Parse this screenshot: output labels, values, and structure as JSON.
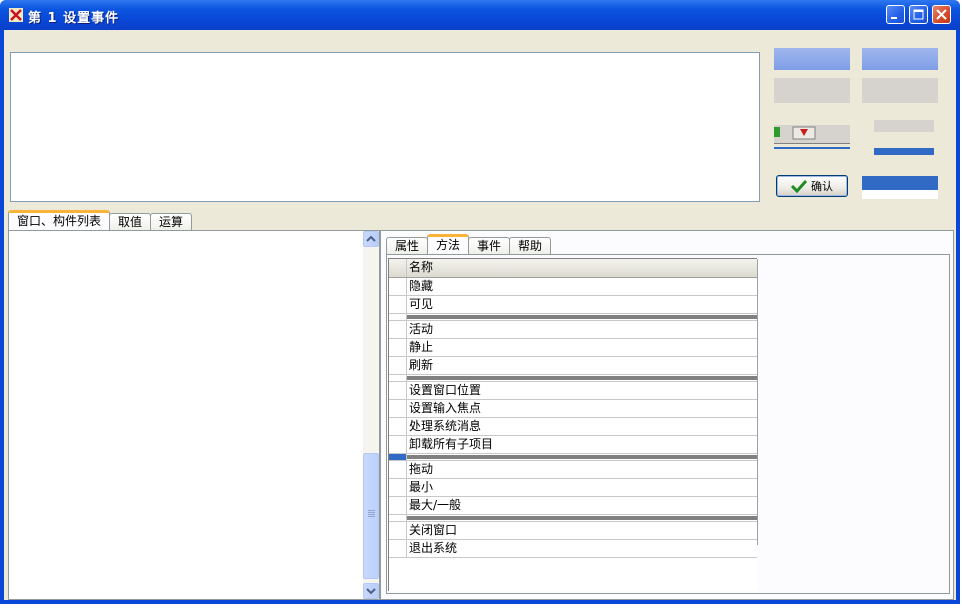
{
  "window": {
    "title": "第 1 设置事件",
    "minimize_icon": "minimize-icon",
    "maximize_icon": "maximize-icon",
    "close_icon": "close-icon"
  },
  "confirm_button": {
    "label": "确认",
    "icon": "check-icon",
    "icon_color": "#1f8a1f"
  },
  "left_tabs": [
    {
      "label": "窗口、构件列表",
      "active": true
    },
    {
      "label": "取值",
      "active": false
    },
    {
      "label": "运算",
      "active": false
    }
  ],
  "right_tabs": [
    {
      "label": "属性",
      "active": false
    },
    {
      "label": "方法",
      "active": true
    },
    {
      "label": "事件",
      "active": false
    },
    {
      "label": "帮助",
      "active": false
    }
  ],
  "methods_table": {
    "header": "名称",
    "rows": [
      {
        "name": "隐藏"
      },
      {
        "name": "可见"
      },
      {
        "separator": true
      },
      {
        "name": "活动"
      },
      {
        "name": "静止"
      },
      {
        "name": "刷新"
      },
      {
        "separator": true
      },
      {
        "name": "设置窗口位置"
      },
      {
        "name": "设置输入焦点"
      },
      {
        "name": "处理系统消息"
      },
      {
        "name": "卸载所有子项目"
      },
      {
        "separator": true,
        "marked": true
      },
      {
        "name": "拖动"
      },
      {
        "name": "最小"
      },
      {
        "name": "最大/一般"
      },
      {
        "separator": true
      },
      {
        "name": "关闭窗口"
      },
      {
        "name": "退出系统"
      }
    ]
  },
  "colors": {
    "titlebar": "#0a55e0",
    "client_bg": "#ece9d8",
    "active_tab_accent": "#f8b439",
    "selection": "#316ac5"
  }
}
